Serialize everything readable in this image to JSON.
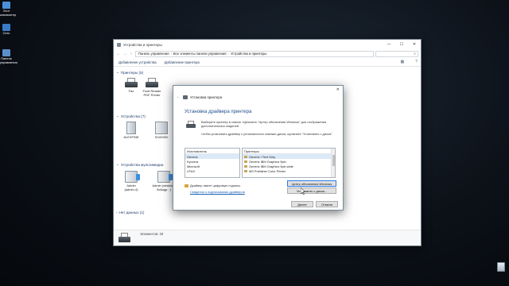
{
  "desktop": {
    "icons": [
      {
        "label": "Этот\nкомпьютер",
        "icon": "computer-icon",
        "color": "#4a90d9"
      },
      {
        "label": "Сеть",
        "icon": "network-icon",
        "color": "#3a7bc8"
      },
      {
        "label": "Панель\nуправления",
        "icon": "control-panel-icon",
        "color": "#5b8fc9"
      }
    ],
    "recycle_icon": "recycle-bin-icon"
  },
  "window": {
    "title": "Устройства и принтеры",
    "controls": {
      "minimize": "—",
      "maximize": "☐",
      "close": "✕"
    },
    "breadcrumb": [
      "Панель управления",
      "Все элементы панели управления",
      "Устройства и принтеры"
    ],
    "search_icon": "⌕",
    "commands": [
      "Добавление устройства",
      "Добавление принтера"
    ],
    "sections": {
      "printers": "Принтеры (5)",
      "devices": "Устройства (7)",
      "multimedia": "Устройства мультимедиа",
      "no_data": "Нет данных (1)"
    },
    "printers": [
      {
        "label": "Fax"
      },
      {
        "label": "Foxit Reader PDF Printer"
      }
    ],
    "devices": [
      {
        "label": "ALEXFINE"
      },
      {
        "label": "S24D300"
      }
    ],
    "media": [
      {
        "label": "Admin (admin-4)"
      },
      {
        "label": "Admin (desktop-5c6agp...)"
      }
    ],
    "status": "Элементов: 20"
  },
  "dialog": {
    "header": "Установка принтера",
    "close": "✕",
    "heading": "Установка драйвера принтера",
    "description": "Выберите принтер в списке. Щелкните \"Центр обновления Windows\" для отображения дополнительных моделей.",
    "description2": "Чтобы установить драйвер с установочного компакт-диска, щелкните \"Установить с диска\".",
    "manufacturers": {
      "header": "Изготовитель",
      "items": [
        "Generic",
        "Kyocera",
        "Microsoft",
        "UTAX"
      ],
      "selected": 0
    },
    "printers": {
      "header": "Принтеры",
      "items": [
        "Generic / Text Only",
        "Generic IBM Graphics 9pin",
        "Generic IBM Graphics 9pin wide",
        "MS Publisher Color Printer"
      ],
      "selected": 0
    },
    "signed_text": "Драйвер имеет цифровую подпись.",
    "signing_link": "Сведения о подписывании драйверов",
    "windows_update_button": "Центр обновления Windows",
    "have_disk_button": "Установить с диска...",
    "next_button": "Далее",
    "cancel_button": "Отмена"
  }
}
